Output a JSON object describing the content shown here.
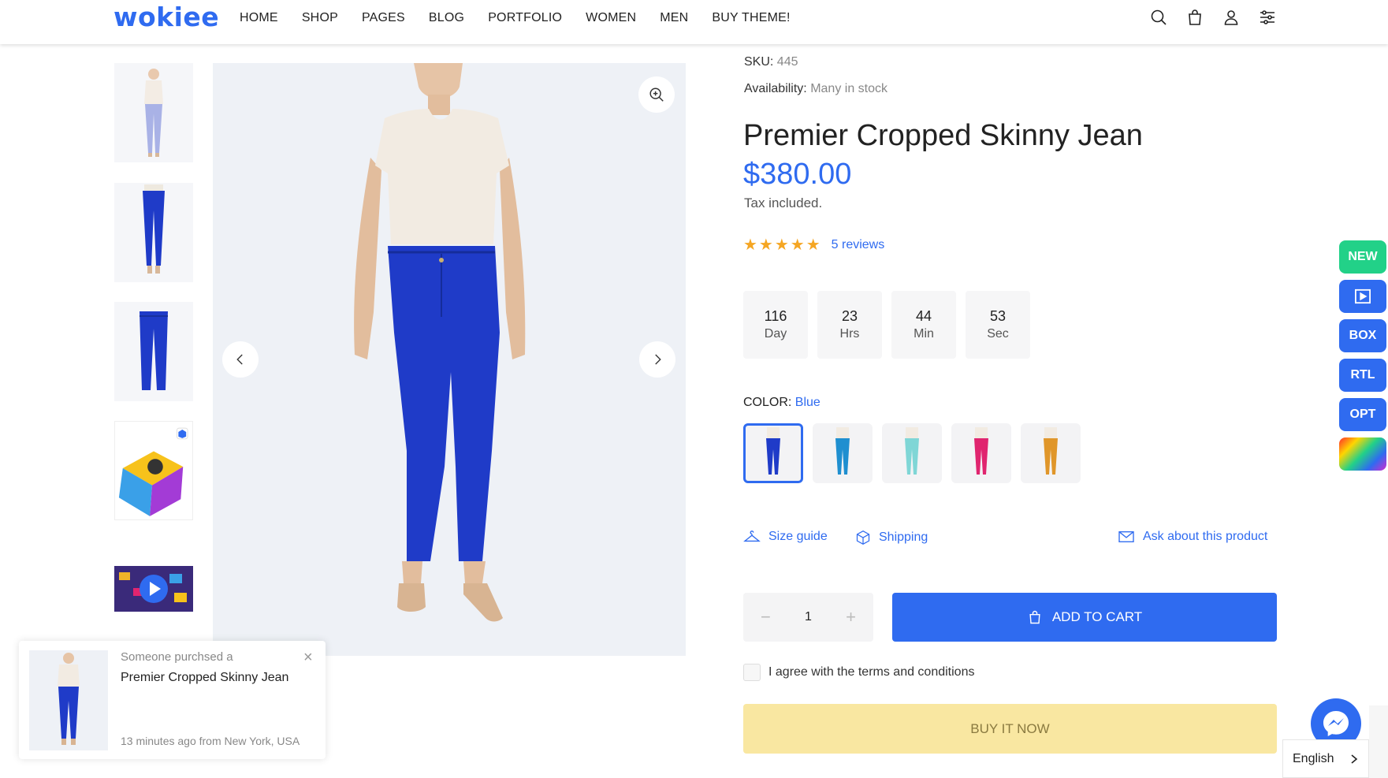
{
  "brand": {
    "logo_text": "wokiee",
    "accent": "#2f6bf0"
  },
  "nav": {
    "items": [
      "HOME",
      "SHOP",
      "PAGES",
      "BLOG",
      "PORTFOLIO",
      "WOMEN",
      "MEN",
      "BUY THEME!"
    ]
  },
  "header_icons": [
    "search-icon",
    "shopping-bag-icon",
    "user-icon",
    "settings-sliders-icon"
  ],
  "product": {
    "sku_label": "SKU:",
    "sku_value": "445",
    "availability_label": "Availability:",
    "availability_value": "Many in stock",
    "title": "Premier Cropped Skinny Jean",
    "price": "$380.00",
    "tax_note": "Tax included.",
    "rating": 4.5,
    "stars": "★★★★★",
    "reviews_text": "5 reviews"
  },
  "countdown": [
    {
      "value": "116",
      "unit": "Day"
    },
    {
      "value": "23",
      "unit": "Hrs"
    },
    {
      "value": "44",
      "unit": "Min"
    },
    {
      "value": "53",
      "unit": "Sec"
    }
  ],
  "color": {
    "label": "COLOR:",
    "selected": "Blue",
    "swatches": [
      {
        "pants": "#1f3bc8",
        "selected": true
      },
      {
        "pants": "#1f8fd0",
        "selected": false
      },
      {
        "pants": "#7fd6d6",
        "selected": false
      },
      {
        "pants": "#e0256f",
        "selected": false
      },
      {
        "pants": "#e0962a",
        "selected": false
      }
    ]
  },
  "links": {
    "size_guide": "Size guide",
    "shipping": "Shipping",
    "ask": "Ask about this product"
  },
  "cart": {
    "minus": "−",
    "quantity": "1",
    "plus": "+",
    "add_to_cart": "ADD TO CART"
  },
  "terms_text": "I agree with the terms and conditions",
  "buy_now": "BUY IT NOW",
  "side_toolbar": {
    "new": "NEW",
    "box": "BOX",
    "rtl": "RTL",
    "opt": "OPT",
    "new_color": "#22d188",
    "btn_color": "#2f6bf0"
  },
  "popup": {
    "small": "Someone purchsed a",
    "title": "Premier Cropped Skinny Jean",
    "time": "13 minutes ago from New York, USA",
    "close": "×"
  },
  "language": "English"
}
